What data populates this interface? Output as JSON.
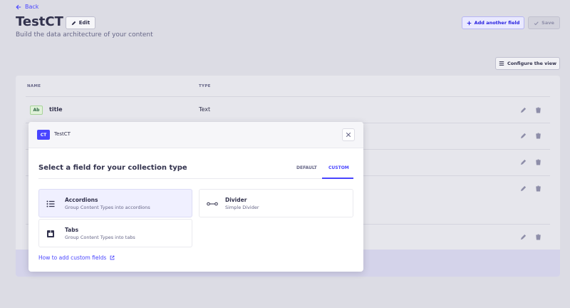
{
  "header": {
    "back_label": "Back",
    "title": "TestCT",
    "edit_label": "Edit",
    "subtitle": "Build the data architecture of your content",
    "add_field_label": "Add another field",
    "save_label": "Save",
    "configure_view_label": "Configure the view"
  },
  "table": {
    "columns": [
      "NAME",
      "TYPE"
    ],
    "rows": [
      {
        "badge": "Ab",
        "name": "title",
        "type": "Text"
      }
    ]
  },
  "modal": {
    "badge": "CT",
    "title": "TestCT",
    "heading": "Select a field for your collection type",
    "tabs": [
      {
        "label": "DEFAULT",
        "selected": false
      },
      {
        "label": "CUSTOM",
        "selected": true
      }
    ],
    "options": [
      {
        "icon": "list-icon",
        "title": "Accordions",
        "description": "Group Content Types into accordions",
        "selected": true
      },
      {
        "icon": "divider-icon",
        "title": "Divider",
        "description": "Simple Divider",
        "selected": false
      },
      {
        "icon": "tabs-icon",
        "title": "Tabs",
        "description": "Group Content Types into tabs",
        "selected": false
      }
    ],
    "help_link": "How to add custom fields"
  },
  "colors": {
    "primary": "#4945ff",
    "text": "#32324d",
    "muted": "#666687",
    "overlay_bg": "#dcdce4"
  }
}
